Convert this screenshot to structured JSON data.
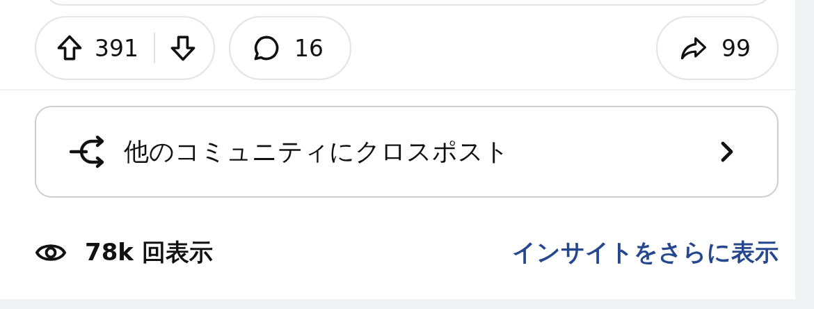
{
  "votes": {
    "score": "391"
  },
  "comments": {
    "count": "16"
  },
  "shares": {
    "count": "99"
  },
  "crosspost": {
    "label": "他のコミュニティにクロスポスト"
  },
  "views": {
    "count": "78k 回表示"
  },
  "insights_link": {
    "label": "インサイトをさらに表示"
  }
}
